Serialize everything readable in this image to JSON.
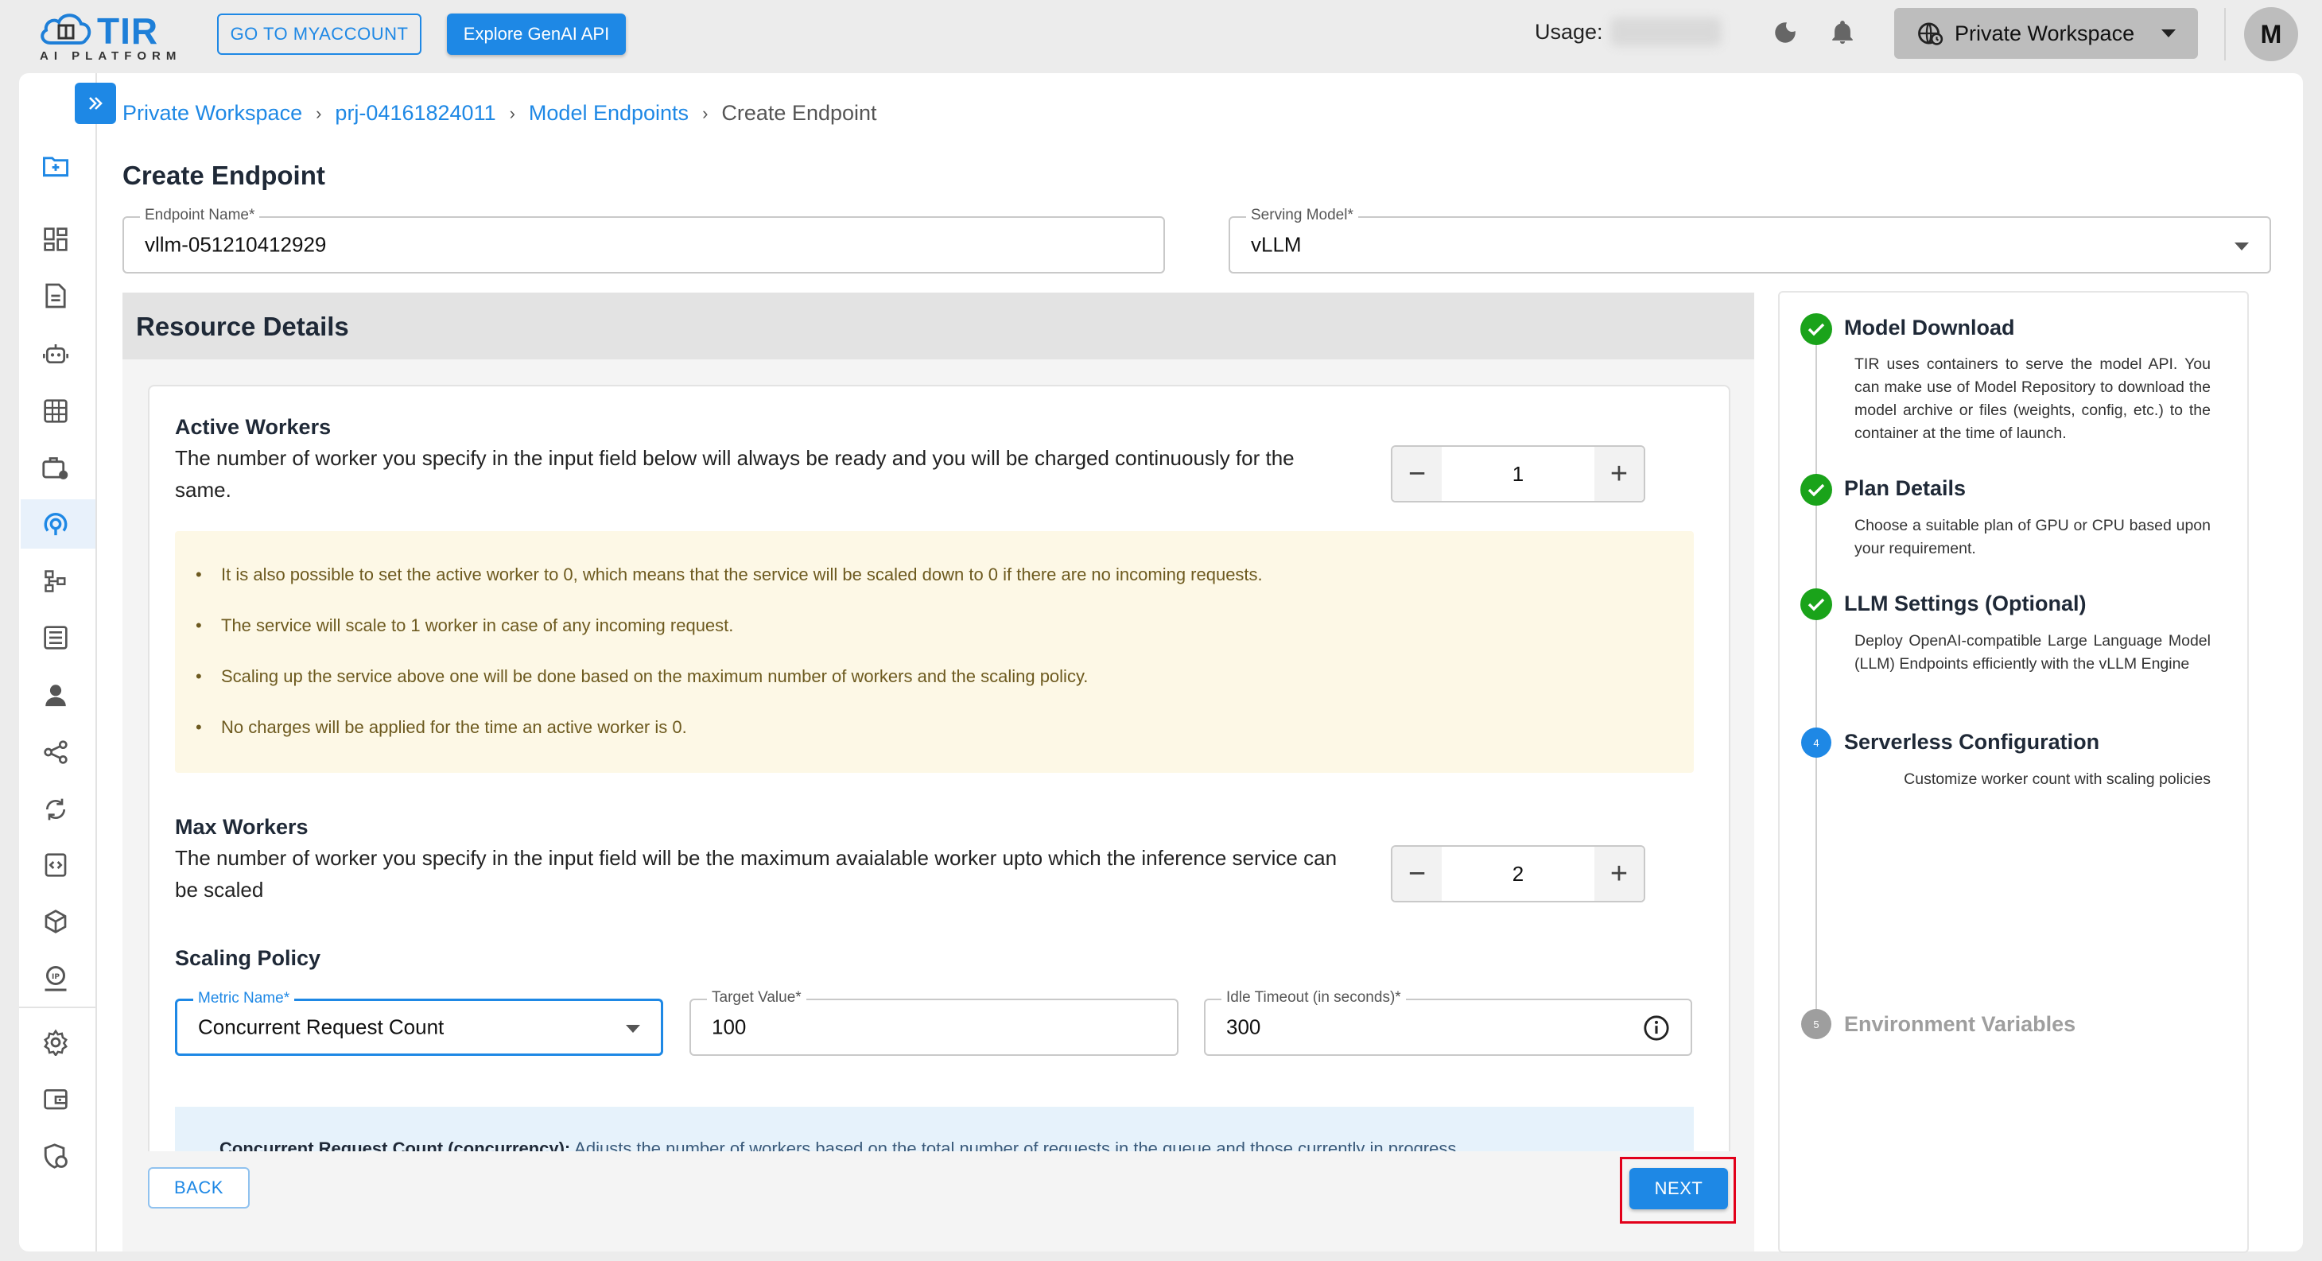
{
  "header": {
    "logo_title": "TIR",
    "logo_subtitle": "AI PLATFORM",
    "myaccount_button": "GO TO MYACCOUNT",
    "genai_button": "Explore GenAI API",
    "usage_label": "Usage:",
    "workspace_selector": "Private Workspace",
    "avatar_initial": "M"
  },
  "sidebar": {
    "icons": [
      "folder-add-icon",
      "dashboard-icon",
      "document-icon",
      "robot-icon",
      "grid-icon",
      "briefcase-icon",
      "inference-icon",
      "pipeline-icon",
      "dataset-icon",
      "user-badge-icon",
      "share-icon",
      "sync-icon",
      "code-icon",
      "cube-icon",
      "ip-icon",
      "settings-icon",
      "wallet-icon",
      "security-icon"
    ],
    "active_index": 6
  },
  "breadcrumb": {
    "items": [
      "Private Workspace",
      "prj-04161824011",
      "Model Endpoints"
    ],
    "current": "Create Endpoint",
    "separator": "›"
  },
  "page": {
    "title": "Create Endpoint"
  },
  "form": {
    "endpoint_name": {
      "label": "Endpoint Name",
      "value": "vllm-051210412929",
      "required": "*"
    },
    "serving_model": {
      "label": "Serving Model",
      "value": "vLLM",
      "required": "*"
    }
  },
  "resource_details": {
    "title": "Resource Details",
    "active_workers": {
      "title": "Active Workers",
      "description": "The number of worker you specify in the input field below will always be ready and you will be charged continuously for the same.",
      "value": "1",
      "notes": [
        "It is also possible to set the active worker to 0, which means that the service will be scaled down to 0 if there are no incoming requests.",
        "The service will scale to 1 worker in case of any incoming request.",
        "Scaling up the service above one will be done based on the maximum number of workers and the scaling policy.",
        "No charges will be applied for the time an active worker is 0."
      ]
    },
    "max_workers": {
      "title": "Max Workers",
      "description": "The number of worker you specify in the input field will be the maximum avaialable worker upto which the inference service can be scaled",
      "value": "2"
    },
    "scaling_policy": {
      "title": "Scaling Policy",
      "metric_name": {
        "label": "Metric Name",
        "value": "Concurrent Request Count",
        "required": "*"
      },
      "target_value": {
        "label": "Target Value",
        "value": "100",
        "required": "*"
      },
      "idle_timeout": {
        "label": "Idle Timeout (in seconds)",
        "value": "300",
        "required": "*"
      },
      "info_bold": "Concurrent Request Count (concurrency):",
      "info_text": "Adjusts the number of workers based on the total number of requests in the queue and those currently in progress."
    }
  },
  "actions": {
    "back": "BACK",
    "next": "NEXT"
  },
  "steps": [
    {
      "title": "Model Download",
      "status": "done",
      "description": "TIR uses containers to serve the model API. You can make use of Model Repository to download the model archive or files (weights, config, etc.) to the container at the time of launch."
    },
    {
      "title": "Plan Details",
      "status": "done",
      "description": "Choose a suitable plan of GPU or CPU based upon your requirement."
    },
    {
      "title": "LLM Settings (Optional)",
      "status": "done",
      "description": "Deploy OpenAI-compatible Large Language Model (LLM) Endpoints efficiently with the vLLM Engine"
    },
    {
      "number": "4",
      "title": "Serverless Configuration",
      "status": "active",
      "description": "Customize worker count with scaling policies"
    },
    {
      "number": "5",
      "title": "Environment Variables",
      "status": "pending",
      "description": ""
    }
  ],
  "colors": {
    "primary": "#1e88e5",
    "success": "#1aa31a",
    "highlight": "#e2001a",
    "note_bg": "#fdf8e6",
    "info_bg": "#e6f2fb"
  }
}
